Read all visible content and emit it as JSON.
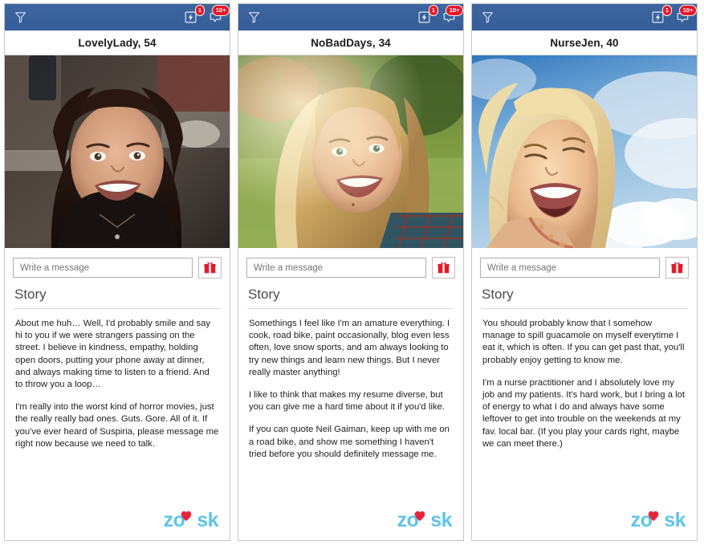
{
  "app": {
    "brand": "zoosk",
    "logo_color": "#5ec5ea",
    "heart_color": "#e8243c",
    "appbar_color": "#39629f",
    "badge_color": "#e8182a"
  },
  "appbar": {
    "filter_icon": "filter-funnel-icon",
    "boost_icon": "boost-lightning-icon",
    "messages_icon": "messages-chat-icon",
    "boost_badge": "1",
    "messages_badge": "10+"
  },
  "common": {
    "message_placeholder": "Write a message",
    "message_value": "",
    "gift_icon": "gift-box-icon",
    "story_heading": "Story"
  },
  "profiles": [
    {
      "name_age": "LovelyLady, 54",
      "photo_alt": "smiling-woman-dark-hair-indoor-selfie",
      "story_paragraphs": [
        "About me huh…  Well, I'd probably smile and say hi to you if we were strangers passing on the street. I believe in kindness, empathy, holding open doors, putting your phone away at dinner, and always making time to listen to a friend. And to throw you a loop…",
        "I'm really into the worst kind of horror movies, just the really really bad ones. Guts. Gore. All of it. If you've ever heard of Suspiria, please message me right now because we need to talk."
      ]
    },
    {
      "name_age": "NoBadDays, 34",
      "photo_alt": "smiling-young-woman-outdoors-sunlit-park",
      "story_paragraphs": [
        "Somethings I feel like I'm an amature everything. I cook, road bike, paint occasionally, blog even less often, love snow sports, and am always looking to try new things and learn new things. But I never really master anything!",
        "I like to think that makes my resume diverse, but you can give me a hard time about it if you'd like.",
        "If you can quote Neil Gaiman, keep up with me on a road bike, and show me something I haven't tried before you should definitely message me."
      ]
    },
    {
      "name_age": "NurseJen, 40",
      "photo_alt": "laughing-blonde-woman-blue-sky-clouds",
      "story_paragraphs": [
        "You should probably know that I somehow manage to spill guacamole on myself everytime I eat it, which is often. If you can get past that, you'll probably enjoy getting to know me.",
        "I'm a nurse practitioner and I absolutely love my job and my patients. It's hard work, but I bring a lot of energy to what I do and always have some leftover to get into trouble on the weekends at my fav. local bar. (If you play your cards right, maybe we can meet there.)"
      ]
    }
  ]
}
